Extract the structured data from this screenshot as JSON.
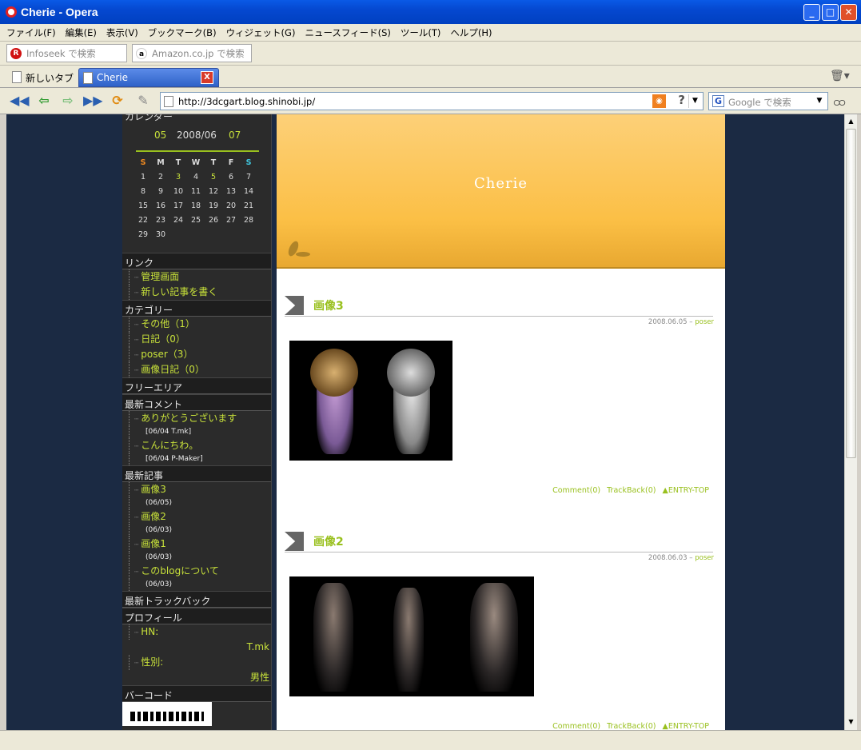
{
  "window": {
    "title": "Cherie - Opera"
  },
  "menu": [
    "ファイル(F)",
    "編集(E)",
    "表示(V)",
    "ブックマーク(B)",
    "ウィジェット(G)",
    "ニュースフィード(S)",
    "ツール(T)",
    "ヘルプ(H)"
  ],
  "search": {
    "infoseek": "Infoseek で検索",
    "amazon": "Amazon.co.jp で検索"
  },
  "tabs": {
    "new_tab": "新しいタブ",
    "active": "Cherie"
  },
  "address": {
    "url": "http://3dcgart.blog.shinobi.jp/",
    "google_placeholder": "Google で検索"
  },
  "sidebar": {
    "calendar_title": "カレンダー",
    "calendar_prev": "05",
    "calendar_month": "2008/06",
    "calendar_next": "07",
    "weekdays": [
      "S",
      "M",
      "T",
      "W",
      "T",
      "F",
      "S"
    ],
    "weeks": [
      [
        "1",
        "2",
        "3",
        "4",
        "5",
        "6",
        "7"
      ],
      [
        "8",
        "9",
        "10",
        "11",
        "12",
        "13",
        "14"
      ],
      [
        "15",
        "16",
        "17",
        "18",
        "19",
        "20",
        "21"
      ],
      [
        "22",
        "23",
        "24",
        "25",
        "26",
        "27",
        "28"
      ],
      [
        "29",
        "30",
        "",
        "",
        "",
        "",
        ""
      ]
    ],
    "links_title": "リンク",
    "links": [
      "管理画面",
      "新しい記事を書く"
    ],
    "category_title": "カテゴリー",
    "categories": [
      "その他（1）",
      "日記（0）",
      "poser（3）",
      "画像日記（0）"
    ],
    "free_title": "フリーエリア",
    "comments_title": "最新コメント",
    "comments": [
      {
        "text": "ありがとうございます",
        "sub": "[06/04 T.mk]"
      },
      {
        "text": "こんにちわ。",
        "sub": "[06/04 P-Maker]"
      }
    ],
    "articles_title": "最新記事",
    "articles": [
      {
        "text": "画像3",
        "sub": "(06/05)"
      },
      {
        "text": "画像2",
        "sub": "(06/03)"
      },
      {
        "text": "画像1",
        "sub": "(06/03)"
      },
      {
        "text": "このblogについて",
        "sub": "(06/03)"
      }
    ],
    "trackback_title": "最新トラックバック",
    "profile_title": "プロフィール",
    "profile_hn_label": "HN:",
    "profile_hn": "T.mk",
    "profile_sex_label": "性別:",
    "profile_sex": "男性",
    "barcode_title": "バーコード"
  },
  "blog": {
    "title": "Cherie",
    "posts": [
      {
        "title": "画像3",
        "date": "2008.06.05",
        "category": "poser",
        "comment": "Comment(0)",
        "trackback": "TrackBack(0)",
        "top": "▲ENTRY-TOP"
      },
      {
        "title": "画像2",
        "date": "2008.06.03",
        "category": "poser",
        "comment": "Comment(0)",
        "trackback": "TrackBack(0)",
        "top": "▲ENTRY-TOP"
      }
    ]
  },
  "colors": {
    "accent": "#99c01e",
    "header": "#fcc24e",
    "sidebar_bg": "#2b2b2b",
    "page_bg": "#1b2a43"
  }
}
